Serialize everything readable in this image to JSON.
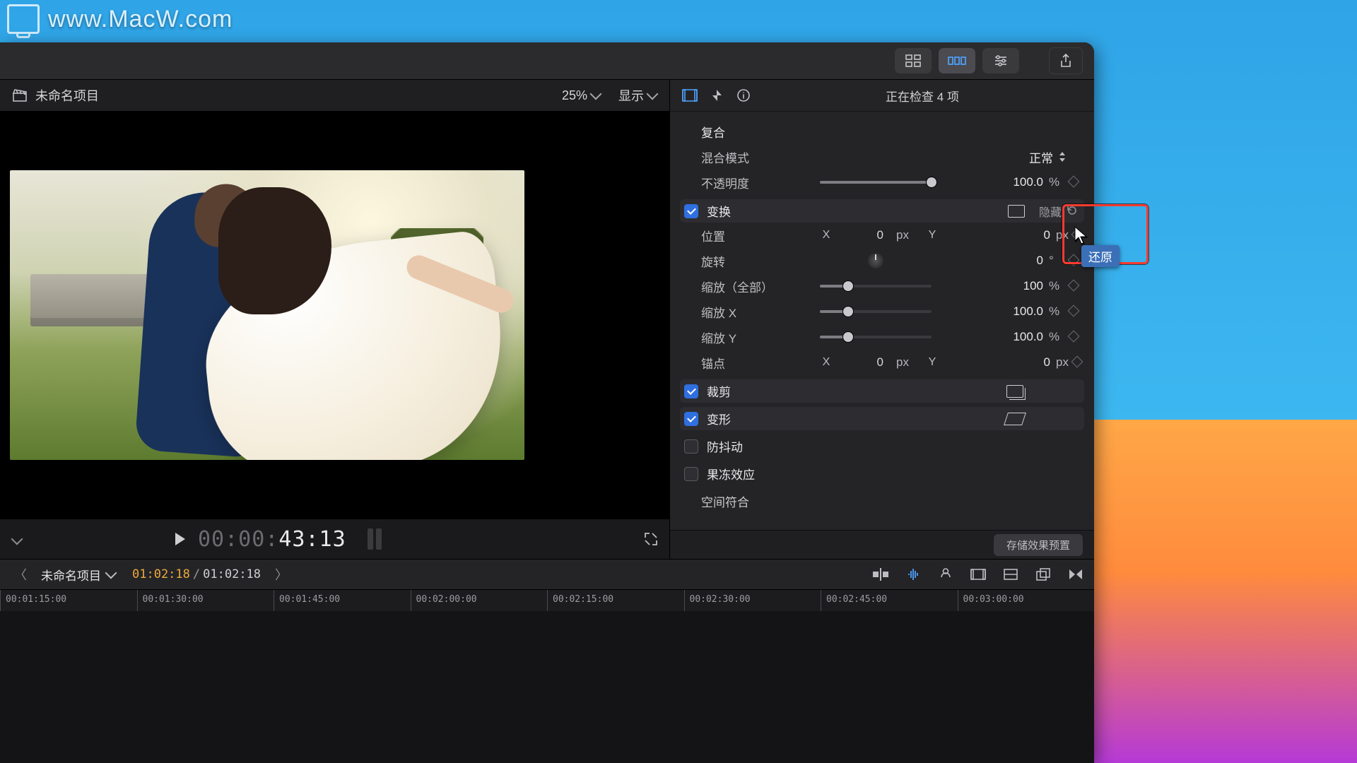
{
  "watermark": "www.MacW.com",
  "viewer": {
    "project_title": "未命名项目",
    "zoom": "25%",
    "view_menu": "显示",
    "timecode_dim": "00:00:",
    "timecode_bright": "43:13"
  },
  "inspector": {
    "title": "正在检查 4 项",
    "composite_section": "复合",
    "blend_mode": {
      "label": "混合模式",
      "value": "正常"
    },
    "opacity": {
      "label": "不透明度",
      "value": "100.0",
      "unit": "%"
    },
    "transform": {
      "title": "变换",
      "hide": "隐藏",
      "position": {
        "label": "位置",
        "x": "0",
        "y": "0",
        "unit": "px"
      },
      "rotation": {
        "label": "旋转",
        "value": "0",
        "unit": "°"
      },
      "scale_all": {
        "label": "缩放（全部）",
        "value": "100",
        "unit": "%"
      },
      "scale_x": {
        "label": "缩放 X",
        "value": "100.0",
        "unit": "%"
      },
      "scale_y": {
        "label": "缩放 Y",
        "value": "100.0",
        "unit": "%"
      },
      "anchor": {
        "label": "锚点",
        "x": "0",
        "y": "0",
        "unit": "px"
      }
    },
    "crop": "裁剪",
    "distort": "变形",
    "stabilize": "防抖动",
    "rolling": "果冻效应",
    "spatial": "空间符合",
    "save_preset": "存储效果预置"
  },
  "tooltip": "还原",
  "timeline": {
    "project": "未命名项目",
    "current": "01:02:18",
    "total": "01:02:18",
    "ruler": [
      "00:01:15:00",
      "00:01:30:00",
      "00:01:45:00",
      "00:02:00:00",
      "00:02:15:00",
      "00:02:30:00",
      "00:02:45:00",
      "00:03:00:00"
    ]
  },
  "xy": {
    "x": "X",
    "y": "Y"
  }
}
